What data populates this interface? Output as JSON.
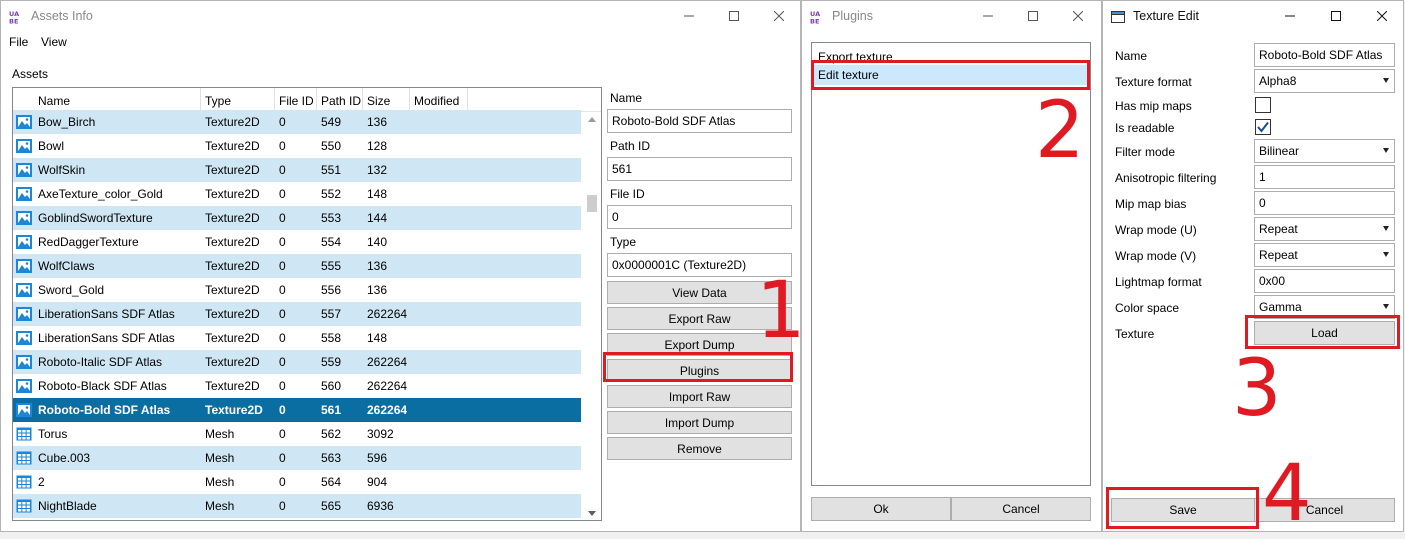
{
  "assets_window": {
    "title": "Assets Info",
    "menu": [
      "File",
      "View"
    ],
    "assets_label": "Assets",
    "columns": [
      "Name",
      "Type",
      "File ID",
      "Path ID",
      "Size",
      "Modified"
    ],
    "rows": [
      {
        "name": "Bow_Birch",
        "type": "Texture2D",
        "file_id": "0",
        "path_id": "549",
        "size": "136",
        "icon": "image-icon"
      },
      {
        "name": "Bowl",
        "type": "Texture2D",
        "file_id": "0",
        "path_id": "550",
        "size": "128",
        "icon": "image-icon"
      },
      {
        "name": "WolfSkin",
        "type": "Texture2D",
        "file_id": "0",
        "path_id": "551",
        "size": "132",
        "icon": "image-icon"
      },
      {
        "name": "AxeTexture_color_Gold",
        "type": "Texture2D",
        "file_id": "0",
        "path_id": "552",
        "size": "148",
        "icon": "image-icon"
      },
      {
        "name": "GoblindSwordTexture",
        "type": "Texture2D",
        "file_id": "0",
        "path_id": "553",
        "size": "144",
        "icon": "image-icon"
      },
      {
        "name": "RedDaggerTexture",
        "type": "Texture2D",
        "file_id": "0",
        "path_id": "554",
        "size": "140",
        "icon": "image-icon"
      },
      {
        "name": "WolfClaws",
        "type": "Texture2D",
        "file_id": "0",
        "path_id": "555",
        "size": "136",
        "icon": "image-icon"
      },
      {
        "name": "Sword_Gold",
        "type": "Texture2D",
        "file_id": "0",
        "path_id": "556",
        "size": "136",
        "icon": "image-icon"
      },
      {
        "name": "LiberationSans SDF Atlas",
        "type": "Texture2D",
        "file_id": "0",
        "path_id": "557",
        "size": "262264",
        "icon": "image-icon"
      },
      {
        "name": "LiberationSans SDF Atlas",
        "type": "Texture2D",
        "file_id": "0",
        "path_id": "558",
        "size": "148",
        "icon": "image-icon"
      },
      {
        "name": "Roboto-Italic SDF Atlas",
        "type": "Texture2D",
        "file_id": "0",
        "path_id": "559",
        "size": "262264",
        "icon": "image-icon"
      },
      {
        "name": "Roboto-Black SDF Atlas",
        "type": "Texture2D",
        "file_id": "0",
        "path_id": "560",
        "size": "262264",
        "icon": "image-icon"
      },
      {
        "name": "Roboto-Bold SDF Atlas",
        "type": "Texture2D",
        "file_id": "0",
        "path_id": "561",
        "size": "262264",
        "icon": "image-icon",
        "selected": true
      },
      {
        "name": "Torus",
        "type": "Mesh",
        "file_id": "0",
        "path_id": "562",
        "size": "3092",
        "icon": "mesh-grid-icon"
      },
      {
        "name": "Cube.003",
        "type": "Mesh",
        "file_id": "0",
        "path_id": "563",
        "size": "596",
        "icon": "mesh-grid-icon"
      },
      {
        "name": "2",
        "type": "Mesh",
        "file_id": "0",
        "path_id": "564",
        "size": "904",
        "icon": "mesh-grid-icon"
      },
      {
        "name": "NightBlade",
        "type": "Mesh",
        "file_id": "0",
        "path_id": "565",
        "size": "6936",
        "icon": "mesh-grid-icon"
      }
    ],
    "details": {
      "name_label": "Name",
      "name_value": "Roboto-Bold SDF Atlas",
      "path_id_label": "Path ID",
      "path_id_value": "561",
      "file_id_label": "File ID",
      "file_id_value": "0",
      "type_label": "Type",
      "type_value": "0x0000001C (Texture2D)"
    },
    "buttons": {
      "view_data": "View Data",
      "export_raw": "Export Raw",
      "export_dump": "Export Dump",
      "plugins": "Plugins",
      "import_raw": "Import Raw",
      "import_dump": "Import Dump",
      "remove": "Remove"
    }
  },
  "plugins_window": {
    "title": "Plugins",
    "items": [
      "Export texture",
      "Edit texture"
    ],
    "ok": "Ok",
    "cancel": "Cancel"
  },
  "texture_edit_window": {
    "title": "Texture Edit",
    "fields": {
      "name_label": "Name",
      "name_value": "Roboto-Bold SDF Atlas",
      "format_label": "Texture format",
      "format_value": "Alpha8",
      "mip_label": "Has mip maps",
      "mip_checked": false,
      "readable_label": "Is readable",
      "readable_checked": true,
      "filter_label": "Filter mode",
      "filter_value": "Bilinear",
      "aniso_label": "Anisotropic filtering",
      "aniso_value": "1",
      "mipbias_label": "Mip map bias",
      "mipbias_value": "0",
      "wrapu_label": "Wrap mode (U)",
      "wrapu_value": "Repeat",
      "wrapv_label": "Wrap mode (V)",
      "wrapv_value": "Repeat",
      "lightmap_label": "Lightmap format",
      "lightmap_value": "0x00",
      "colorspace_label": "Color space",
      "colorspace_value": "Gamma",
      "texture_label": "Texture"
    },
    "load": "Load",
    "save": "Save",
    "cancel": "Cancel"
  },
  "annotations": {
    "step1": "1",
    "step2": "2",
    "step3": "3",
    "step4": "4"
  },
  "colors": {
    "selection": "#0a6ea3",
    "alt_row": "#cfe7f5",
    "highlight": "#e01a22",
    "list_hover": "#cce8ff"
  }
}
